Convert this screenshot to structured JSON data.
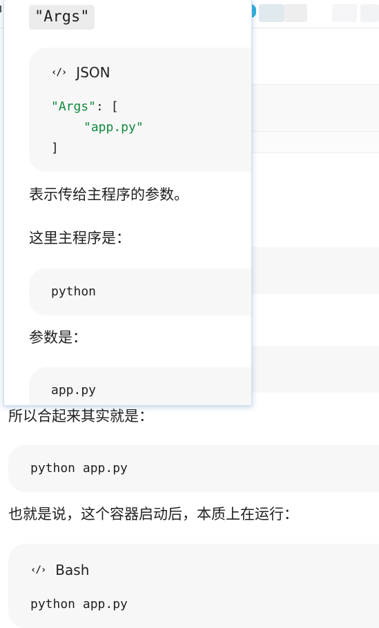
{
  "popup": {
    "inline_code": "\"Args\"",
    "json_block": {
      "language": "JSON",
      "icon": "code-icon",
      "lines": {
        "l1_key": "\"Args\"",
        "l1_rest": ": [",
        "l2_value": "\"app.py\"",
        "l3": "]"
      }
    },
    "desc": "表示传给主程序的参数。",
    "main_program_label": "这里主程序是：",
    "main_program_code": "python",
    "args_label": "参数是：",
    "args_code": "app.py"
  },
  "page": {
    "combined_label": "所以合起来其实就是：",
    "combined_code": "python app.py",
    "running_label": "也就是说，这个容器启动后，本质上在运行：",
    "bash_block": {
      "language": "Bash",
      "icon": "code-icon",
      "code": "python app.py"
    }
  },
  "colors": {
    "json_string": "#118a3b",
    "code_bg": "#f7f7f7",
    "popup_border": "#cfe0f5"
  }
}
